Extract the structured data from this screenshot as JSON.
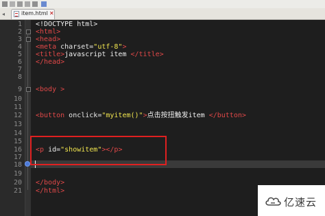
{
  "tab": {
    "label": "item.html",
    "close": "✕"
  },
  "line_numbers": [
    "1",
    "2",
    "3",
    "4",
    "5",
    "6",
    "7",
    "8",
    "9",
    "10",
    "11",
    "12",
    "13",
    "14",
    "15",
    "16",
    "17",
    "18",
    "19",
    "20",
    "21"
  ],
  "code": {
    "l1": "<!DOCTYPE html>",
    "l2_tag": "<html>",
    "l3_tag": "<head>",
    "l4_open": "<meta",
    "l4_attr": " charset=",
    "l4_val": "\"utf-8\"",
    "l4_close": ">",
    "l5_open": "<title>",
    "l5_text": "javascript item ",
    "l5_close": "</title>",
    "l6_tag": "</head>",
    "l9_tag": "<body >",
    "l13_open": "<button",
    "l13_attr": " onclick=",
    "l13_val": "\"myitem()\"",
    "l13_gt": ">",
    "l13_text": "点击按扭触发item ",
    "l13_close": "</button>",
    "l16_open": "<p",
    "l16_attr": " id=",
    "l16_val": "\"showitem\"",
    "l16_close": "></p>",
    "l20_tag": "</body>",
    "l21_tag": "</html>"
  },
  "watermark": {
    "text": "亿速云"
  },
  "colors": {
    "tag": "#e04848",
    "string": "#f2e64f",
    "text": "#f0f0f0",
    "highlight_box": "#e02020",
    "bookmark": "#4a78d8"
  },
  "icons": [
    "save-icon",
    "html-file-icon",
    "tab-close-icon",
    "fold-toggle-icon",
    "bookmark-icon",
    "cloud-logo-icon"
  ]
}
